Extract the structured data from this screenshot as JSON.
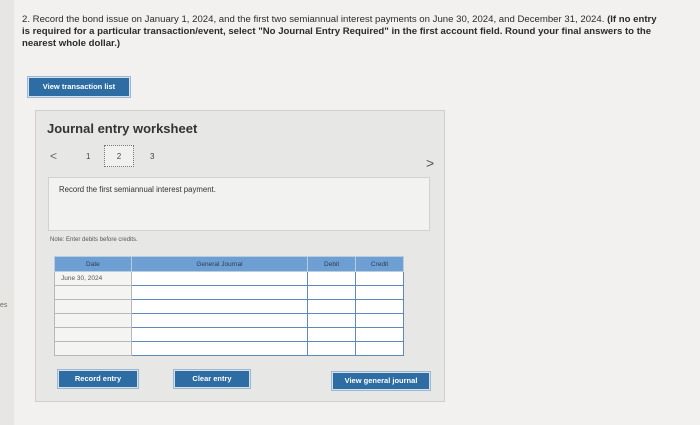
{
  "sidebar_edge_text": "es",
  "question": {
    "lead": "2. Record the bond issue on January 1, 2024, and the first two semiannual interest payments on June 30, 2024, and December 31, 2024.",
    "bold": "(If no entry is required for a particular transaction/event, select \"No Journal Entry Required\" in the first account field. Round your final answers to the nearest whole dollar.)"
  },
  "buttons": {
    "view_transaction_list": "View transaction list",
    "record_entry": "Record entry",
    "clear_entry": "Clear entry",
    "view_general_journal": "View general journal"
  },
  "worksheet": {
    "title": "Journal entry worksheet",
    "pages": [
      "1",
      "2",
      "3"
    ],
    "current_page": "2",
    "prev_symbol": "<",
    "next_symbol": ">",
    "instruction": "Record the first semiannual interest payment.",
    "note": "Note: Enter debits before credits."
  },
  "journal_table": {
    "headers": {
      "date": "Date",
      "account": "General Journal",
      "debit": "Debit",
      "credit": "Credit"
    },
    "rows": [
      {
        "date": "June 30, 2024",
        "account": "",
        "debit": "",
        "credit": ""
      },
      {
        "date": "",
        "account": "",
        "debit": "",
        "credit": ""
      },
      {
        "date": "",
        "account": "",
        "debit": "",
        "credit": ""
      },
      {
        "date": "",
        "account": "",
        "debit": "",
        "credit": ""
      },
      {
        "date": "",
        "account": "",
        "debit": "",
        "credit": ""
      },
      {
        "date": "",
        "account": "",
        "debit": "",
        "credit": ""
      }
    ]
  },
  "colors": {
    "button": "#2e6da4",
    "table_header": "#6e9fd3",
    "panel": "#e7e7e5"
  }
}
